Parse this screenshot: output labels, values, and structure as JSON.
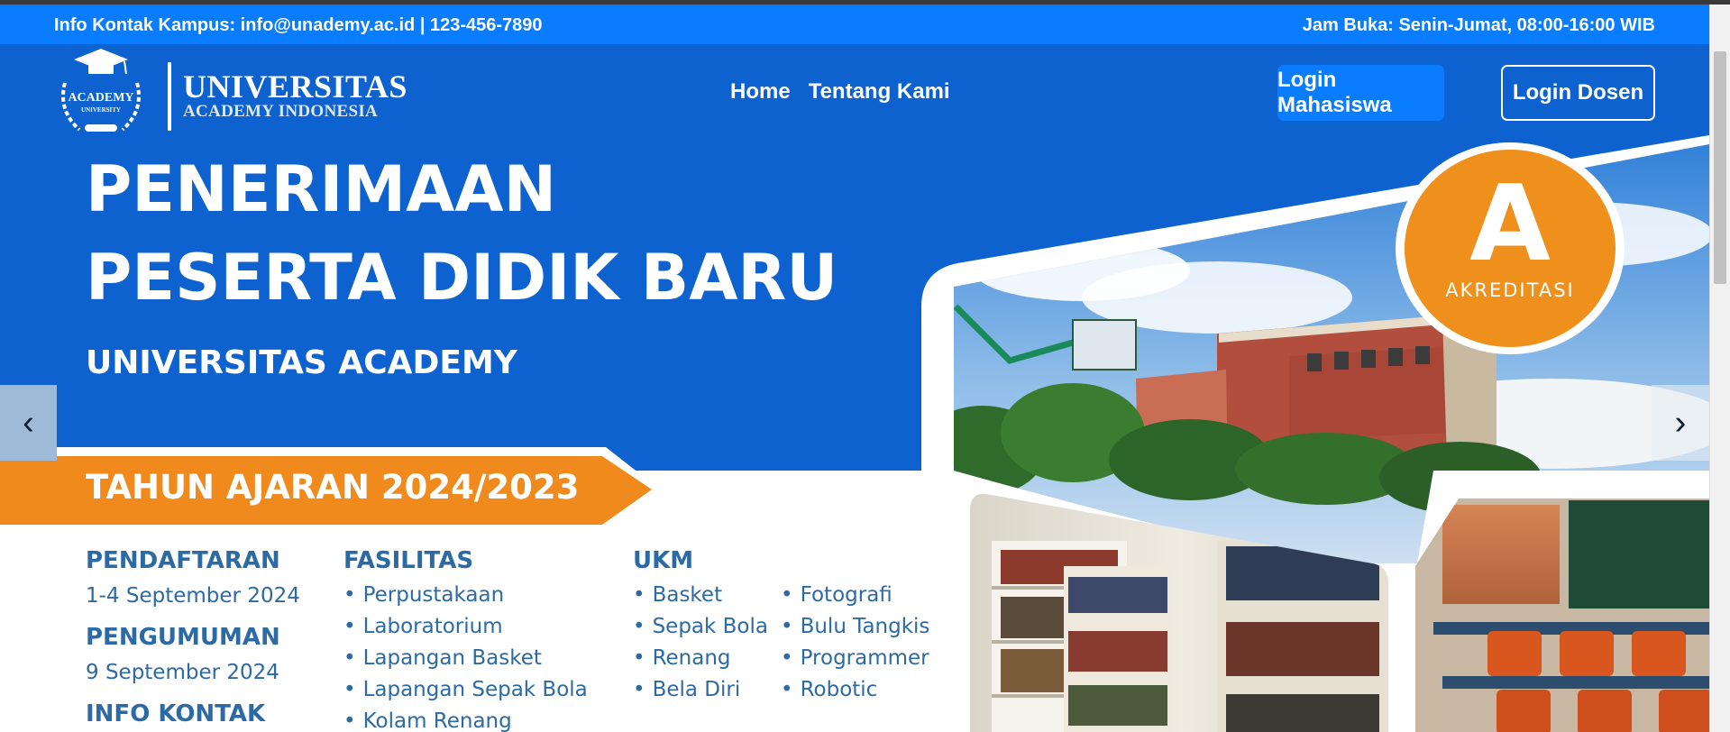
{
  "info_bar": {
    "left_text": "Info Kontak Kampus: info@unademy.ac.id | 123-456-7890",
    "right_text": "Jam Buka: Senin-Jumat, 08:00-16:00 WIB"
  },
  "logo": {
    "emblem_line1": "ACADEMY",
    "emblem_line2": "UNIVERSITY",
    "title": "UNIVERSITAS",
    "subtitle": "ACADEMY INDONESIA"
  },
  "nav": {
    "links": [
      "Home",
      "Tentang Kami"
    ],
    "login_student": "Login Mahasiswa",
    "login_lecturer": "Login Dosen"
  },
  "hero": {
    "line1": "PENERIMAAN",
    "line2": "PESERTA DIDIK BARU",
    "subtitle": "UNIVERSITAS ACADEMY",
    "banner": "TAHUN AJARAN 2024/2023",
    "badge_letter": "A",
    "badge_label": "AKREDITASI",
    "prev_glyph": "‹",
    "next_glyph": "›"
  },
  "info": {
    "registration_label": "PENDAFTARAN",
    "registration_date": "1-4 September 2024",
    "announcement_label": "PENGUMUMAN",
    "announcement_date": "9 September 2024",
    "contact_label": "INFO KONTAK"
  },
  "facilities": {
    "label": "FASILITAS",
    "items": [
      "Perpustakaan",
      "Laboratorium",
      "Lapangan Basket",
      "Lapangan Sepak Bola",
      "Kolam Renang"
    ]
  },
  "ukm": {
    "label": "UKM",
    "col1": [
      "Basket",
      "Sepak Bola",
      "Renang",
      "Bela Diri"
    ],
    "col2": [
      "Fotografi",
      "Bulu Tangkis",
      "Programmer",
      "Robotic"
    ]
  },
  "colors": {
    "info_bar": "#0a7cff",
    "hero_blue": "#0d62cf",
    "banner_orange": "#f08a1c",
    "text_blue": "#2c6aa6",
    "badge_orange": "#f0901c"
  }
}
